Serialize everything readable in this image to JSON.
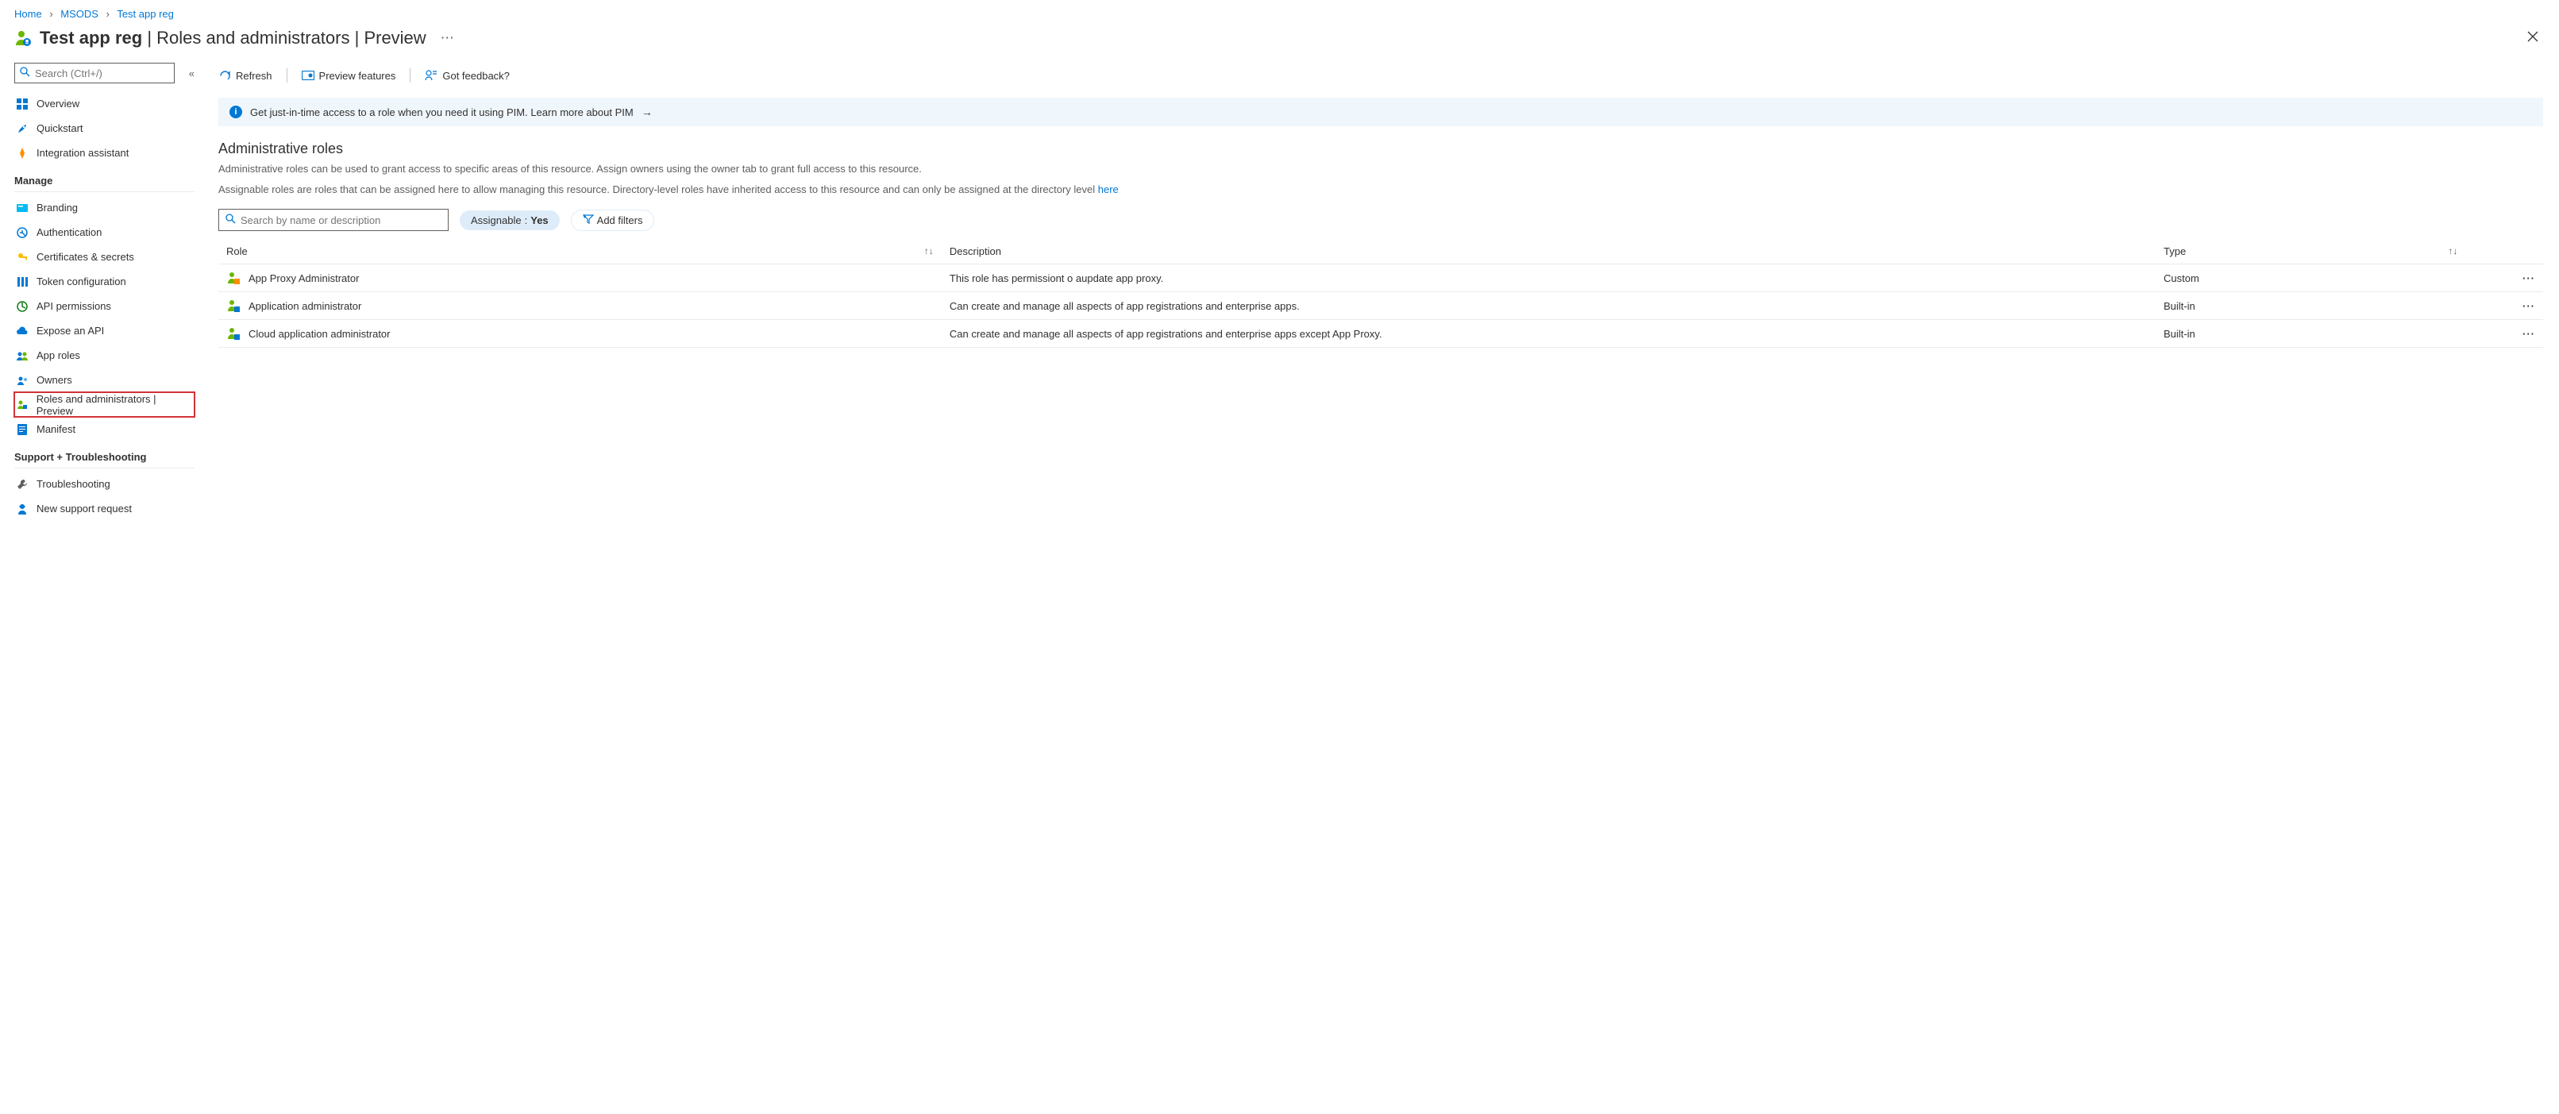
{
  "breadcrumb": {
    "home": "Home",
    "org": "MSODS",
    "app": "Test app reg"
  },
  "title": {
    "app_name": "Test app reg",
    "page": "Roles and administrators",
    "suffix": "Preview"
  },
  "sidebar": {
    "search_placeholder": "Search (Ctrl+/)",
    "items": [
      {
        "label": "Overview"
      },
      {
        "label": "Quickstart"
      },
      {
        "label": "Integration assistant"
      }
    ],
    "manage_head": "Manage",
    "manage_items": [
      {
        "label": "Branding"
      },
      {
        "label": "Authentication"
      },
      {
        "label": "Certificates & secrets"
      },
      {
        "label": "Token configuration"
      },
      {
        "label": "API permissions"
      },
      {
        "label": "Expose an API"
      },
      {
        "label": "App roles"
      },
      {
        "label": "Owners"
      },
      {
        "label": "Roles and administrators | Preview"
      },
      {
        "label": "Manifest"
      }
    ],
    "support_head": "Support + Troubleshooting",
    "support_items": [
      {
        "label": "Troubleshooting"
      },
      {
        "label": "New support request"
      }
    ]
  },
  "commands": {
    "refresh": "Refresh",
    "preview": "Preview features",
    "feedback": "Got feedback?"
  },
  "banner": {
    "text": "Get just-in-time access to a role when you need it using PIM. Learn more about PIM"
  },
  "section": {
    "title": "Administrative roles",
    "desc1": "Administrative roles can be used to grant access to specific areas of this resource. Assign owners using the owner tab to grant full access to this resource.",
    "desc2_pre": "Assignable roles are roles that can be assigned here to allow managing this resource. Directory-level roles have inherited access to this resource and can only be assigned at the directory level ",
    "desc2_link": "here"
  },
  "filters": {
    "search_placeholder": "Search by name or description",
    "assignable_key": "Assignable",
    "assignable_value": "Yes",
    "add_filters": "Add filters"
  },
  "table": {
    "cols": {
      "role": "Role",
      "description": "Description",
      "type": "Type"
    },
    "rows": [
      {
        "name": "App Proxy Administrator",
        "description": "This role has permissiont o aupdate app proxy.",
        "type": "Custom"
      },
      {
        "name": "Application administrator",
        "description": "Can create and manage all aspects of app registrations and enterprise apps.",
        "type": "Built-in"
      },
      {
        "name": "Cloud application administrator",
        "description": "Can create and manage all aspects of app registrations and enterprise apps except App Proxy.",
        "type": "Built-in"
      }
    ]
  }
}
